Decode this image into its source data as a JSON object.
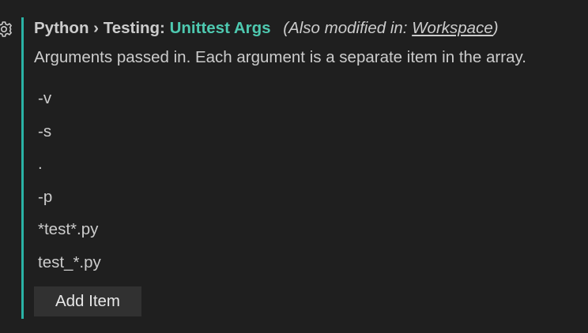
{
  "setting": {
    "category": "Python",
    "separator": " › ",
    "subcategory": "Testing:",
    "label": "Unittest Args",
    "also_prefix": "(Also modified in: ",
    "also_scope": "Workspace",
    "also_suffix": ")",
    "description": "Arguments passed in. Each argument is a separate item in the array.",
    "items": [
      {
        "value": "-v"
      },
      {
        "value": "-s"
      },
      {
        "value": "."
      },
      {
        "value": "-p"
      },
      {
        "value": "*test*.py"
      },
      {
        "value": "test_*.py"
      }
    ],
    "add_button_label": "Add Item"
  },
  "colors": {
    "background": "#1f1f1f",
    "text": "#cccccc",
    "label_accent": "#4ec9b0",
    "modified_indicator": "#2ab3a6",
    "button_background": "#313131"
  },
  "icons": {
    "settings_gear": "gear-icon"
  }
}
